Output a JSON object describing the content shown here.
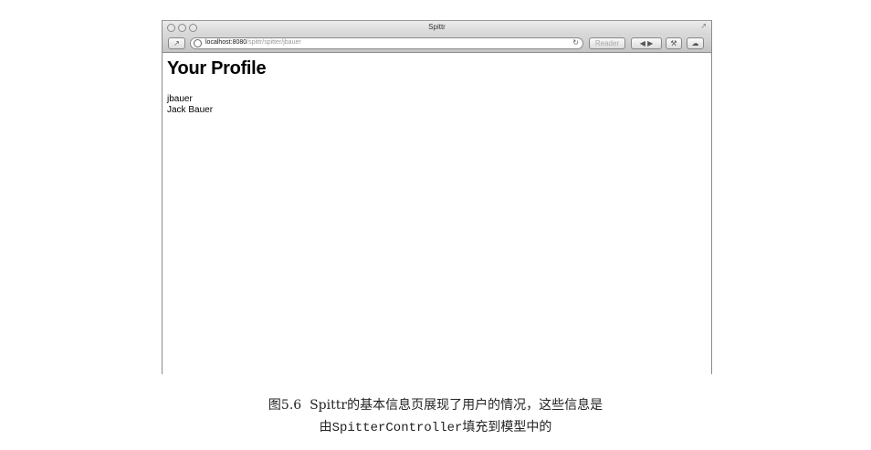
{
  "window": {
    "title": "Spittr",
    "url_host": "localhost:8080",
    "url_path": "/spittr/spitter/jbauer",
    "reader_label": "Reader"
  },
  "page": {
    "heading": "Your Profile",
    "username": "jbauer",
    "full_name": "Jack Bauer"
  },
  "caption": {
    "figure_number": "图5.6",
    "line1": "Spittr的基本信息页展现了用户的情况，这些信息是",
    "line2_prefix": "由",
    "line2_code": "SpitterController",
    "line2_suffix": "填充到模型中的"
  }
}
